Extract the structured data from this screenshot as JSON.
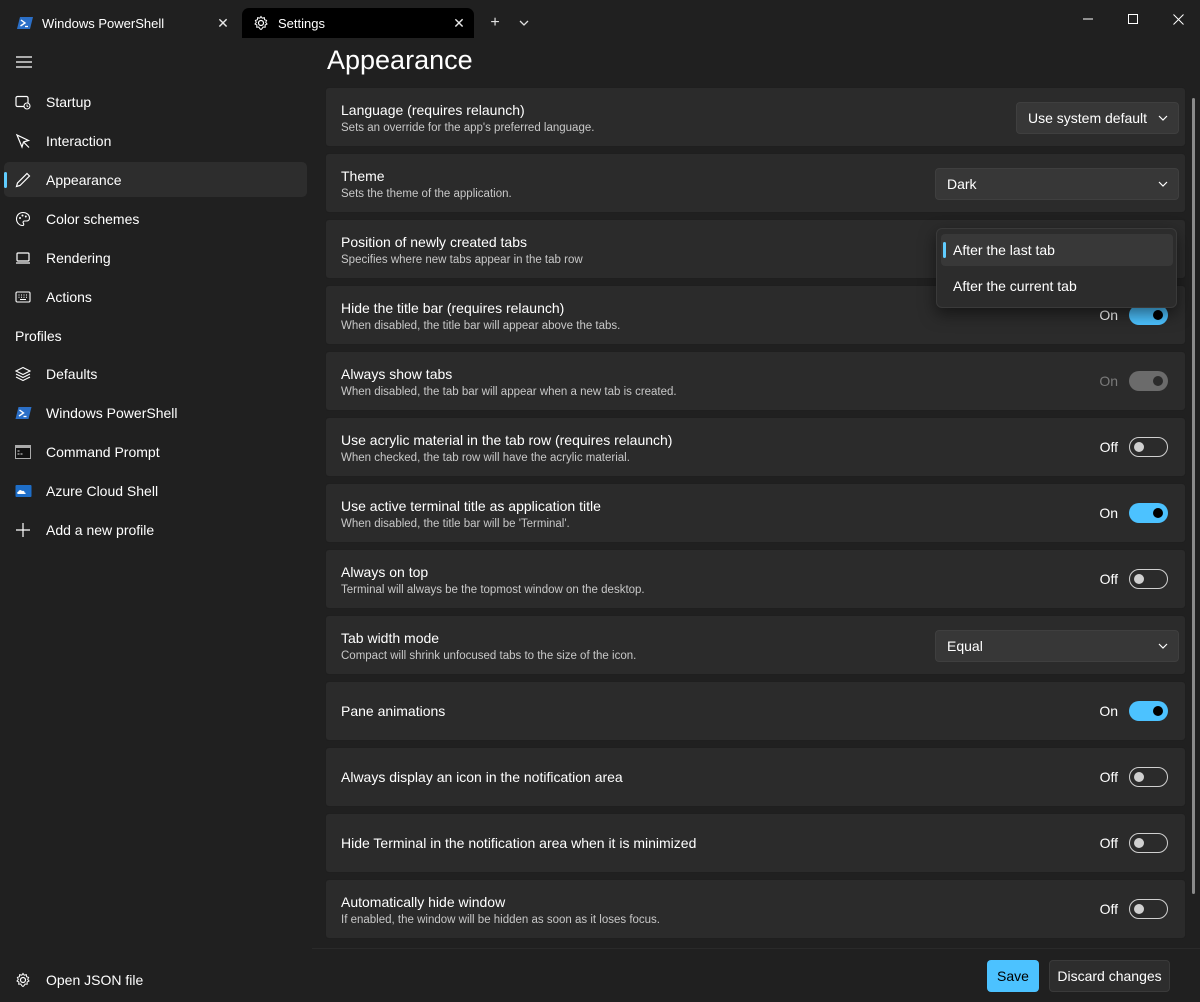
{
  "tabs": [
    {
      "label": "Windows PowerShell",
      "icon": "powershell-icon"
    },
    {
      "label": "Settings",
      "icon": "gear-icon"
    }
  ],
  "sidebar": {
    "items": [
      {
        "label": "Startup",
        "icon": "startup-icon"
      },
      {
        "label": "Interaction",
        "icon": "interaction-icon"
      },
      {
        "label": "Appearance",
        "icon": "pen-icon",
        "selected": true
      },
      {
        "label": "Color schemes",
        "icon": "palette-icon"
      },
      {
        "label": "Rendering",
        "icon": "monitor-icon"
      },
      {
        "label": "Actions",
        "icon": "keyboard-icon"
      }
    ],
    "profiles_header": "Profiles",
    "profiles": [
      {
        "label": "Defaults",
        "icon": "layers-icon"
      },
      {
        "label": "Windows PowerShell",
        "icon": "powershell-icon"
      },
      {
        "label": "Command Prompt",
        "icon": "cmd-icon"
      },
      {
        "label": "Azure Cloud Shell",
        "icon": "azure-icon"
      },
      {
        "label": "Add a new profile",
        "icon": "plus-icon"
      }
    ],
    "open_json": {
      "label": "Open JSON file",
      "icon": "gear-icon"
    }
  },
  "main": {
    "title": "Appearance",
    "settings": [
      {
        "title": "Language (requires relaunch)",
        "desc": "Sets an override for the app's preferred language.",
        "control": "dropdown",
        "value": "Use system default"
      },
      {
        "title": "Theme",
        "desc": "Sets the theme of the application.",
        "control": "dropdown",
        "value": "Dark"
      },
      {
        "title": "Position of newly created tabs",
        "desc": "Specifies where new tabs appear in the tab row",
        "control": "dropdown-open"
      },
      {
        "title": "Hide the title bar (requires relaunch)",
        "desc": "When disabled, the title bar will appear above the tabs.",
        "control": "toggle",
        "state": "On"
      },
      {
        "title": "Always show tabs",
        "desc": "When disabled, the tab bar will appear when a new tab is created.",
        "control": "toggle-disabled",
        "state": "On"
      },
      {
        "title": "Use acrylic material in the tab row (requires relaunch)",
        "desc": "When checked, the tab row will have the acrylic material.",
        "control": "toggle",
        "state": "Off"
      },
      {
        "title": "Use active terminal title as application title",
        "desc": "When disabled, the title bar will be 'Terminal'.",
        "control": "toggle",
        "state": "On"
      },
      {
        "title": "Always on top",
        "desc": "Terminal will always be the topmost window on the desktop.",
        "control": "toggle",
        "state": "Off"
      },
      {
        "title": "Tab width mode",
        "desc": "Compact will shrink unfocused tabs to the size of the icon.",
        "control": "dropdown",
        "value": "Equal"
      },
      {
        "title": "Pane animations",
        "desc": "",
        "control": "toggle",
        "state": "On"
      },
      {
        "title": "Always display an icon in the notification area",
        "desc": "",
        "control": "toggle",
        "state": "Off"
      },
      {
        "title": "Hide Terminal in the notification area when it is minimized",
        "desc": "",
        "control": "toggle",
        "state": "Off"
      },
      {
        "title": "Automatically hide window",
        "desc": "If enabled, the window will be hidden as soon as it loses focus.",
        "control": "toggle",
        "state": "Off"
      }
    ],
    "flyout_options": [
      "After the last tab",
      "After the current tab"
    ]
  },
  "buttons": {
    "save": "Save",
    "discard": "Discard changes"
  },
  "colors": {
    "accent": "#4cc2ff",
    "background": "#202020",
    "card": "#2b2b2b"
  }
}
